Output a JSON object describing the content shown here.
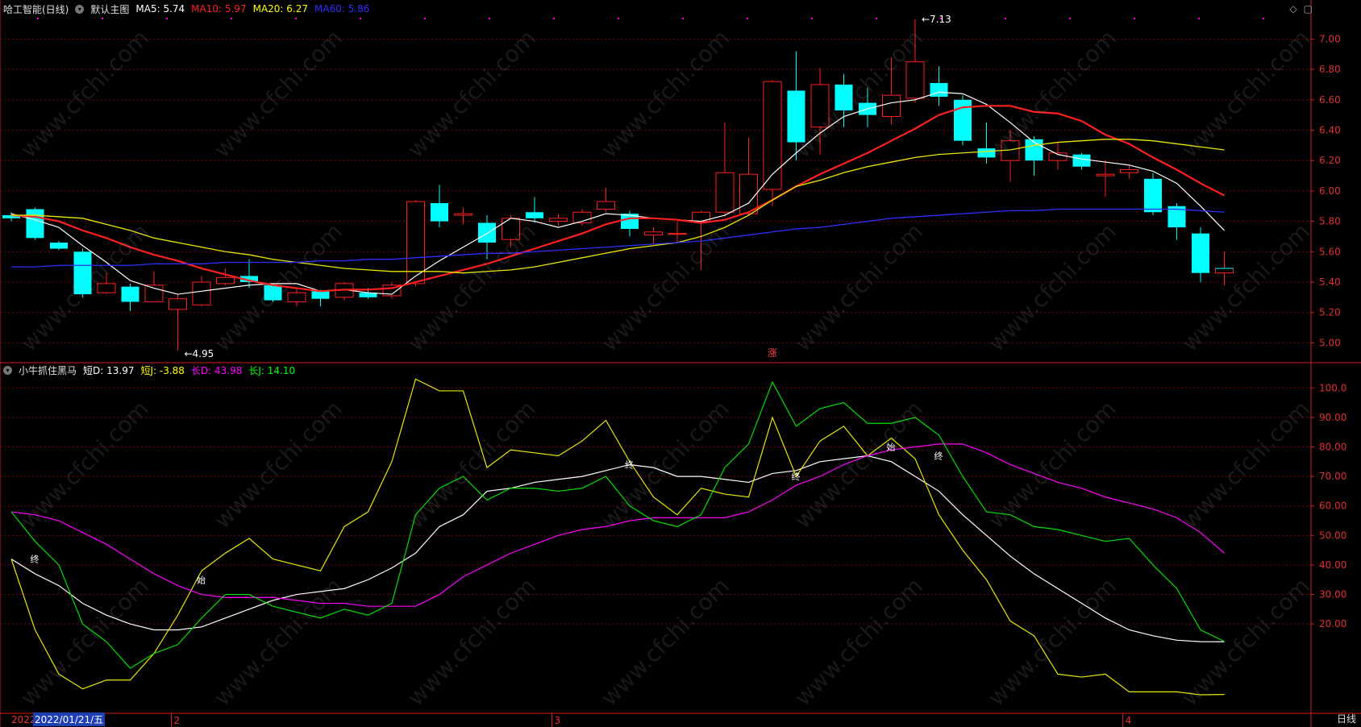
{
  "header": {
    "stock": "哈工智能(日线)",
    "template": "默认主图",
    "ma": [
      {
        "label": "MA5: 5.74",
        "color": "#ffffff"
      },
      {
        "label": "MA10: 5.97",
        "color": "#ff2020"
      },
      {
        "label": "MA20: 6.27",
        "color": "#ffff00"
      },
      {
        "label": "MA60: 5.86",
        "color": "#2f2fff"
      }
    ]
  },
  "indicator": {
    "name": "小牛抓住黑马",
    "items": [
      {
        "label": "短D: 13.97",
        "color": "#ffffff"
      },
      {
        "label": "短J: -3.88",
        "color": "#ffff00"
      },
      {
        "label": "长D: 43.98",
        "color": "#ff00ff"
      },
      {
        "label": "长J: 14.10",
        "color": "#00ff00"
      }
    ]
  },
  "footer": {
    "year": "2022",
    "date": "2022/01/21/五",
    "period": "日线"
  },
  "watermark": "www.cfchi.com",
  "colors": {
    "up": "#ff2020",
    "down": "#00ffff",
    "grid": "#7a0000",
    "axis": "#d21e1e"
  },
  "chart_data": {
    "type": "candlestick",
    "price_axis": {
      "ylim": [
        4.88,
        7.14
      ],
      "ticks": [
        "5.00",
        "5.20",
        "5.40",
        "5.60",
        "5.80",
        "6.00",
        "6.20",
        "6.40",
        "6.60",
        "6.80",
        "7.00"
      ]
    },
    "indicator_axis": {
      "ylim": [
        -10,
        108
      ],
      "ticks": [
        "20.00",
        "30.00",
        "40.00",
        "50.00",
        "60.00",
        "70.00",
        "80.00",
        "90.00",
        "100.0"
      ]
    },
    "month_labels": [
      {
        "label": "2",
        "index": 7
      },
      {
        "label": "3",
        "index": 23
      },
      {
        "label": "4",
        "index": 47
      }
    ],
    "candles": [
      [
        5.84,
        5.82,
        5.86,
        5.8
      ],
      [
        5.88,
        5.69,
        5.89,
        5.68
      ],
      [
        5.66,
        5.62,
        5.67,
        5.61
      ],
      [
        5.6,
        5.32,
        5.62,
        5.3
      ],
      [
        5.33,
        5.39,
        5.46,
        5.32
      ],
      [
        5.37,
        5.27,
        5.39,
        5.21
      ],
      [
        5.27,
        5.38,
        5.47,
        5.27
      ],
      [
        5.22,
        5.29,
        5.32,
        4.95
      ],
      [
        5.25,
        5.4,
        5.44,
        5.24
      ],
      [
        5.39,
        5.43,
        5.49,
        5.38
      ],
      [
        5.44,
        5.4,
        5.55,
        5.36
      ],
      [
        5.38,
        5.28,
        5.39,
        5.27
      ],
      [
        5.27,
        5.33,
        5.36,
        5.24
      ],
      [
        5.34,
        5.29,
        5.35,
        5.24
      ],
      [
        5.3,
        5.39,
        5.4,
        5.28
      ],
      [
        5.33,
        5.3,
        5.36,
        5.29
      ],
      [
        5.31,
        5.38,
        5.4,
        5.29
      ],
      [
        5.39,
        5.93,
        5.94,
        5.37
      ],
      [
        5.92,
        5.8,
        6.04,
        5.76
      ],
      [
        5.84,
        5.85,
        5.89,
        5.78
      ],
      [
        5.79,
        5.66,
        5.84,
        5.55
      ],
      [
        5.68,
        5.82,
        5.84,
        5.63
      ],
      [
        5.86,
        5.82,
        5.96,
        5.79
      ],
      [
        5.8,
        5.82,
        5.85,
        5.77
      ],
      [
        5.79,
        5.86,
        5.88,
        5.77
      ],
      [
        5.88,
        5.93,
        6.02,
        5.86
      ],
      [
        5.85,
        5.75,
        5.87,
        5.7
      ],
      [
        5.71,
        5.73,
        5.76,
        5.65
      ],
      [
        5.72,
        5.72,
        5.8,
        5.66
      ],
      [
        5.8,
        5.86,
        5.87,
        5.48
      ],
      [
        5.86,
        6.12,
        6.45,
        5.83
      ],
      [
        5.85,
        6.11,
        6.35,
        5.84
      ],
      [
        6.01,
        6.72,
        6.73,
        5.9
      ],
      [
        6.66,
        6.32,
        6.92,
        6.2
      ],
      [
        6.42,
        6.7,
        6.81,
        6.24
      ],
      [
        6.7,
        6.53,
        6.77,
        6.42
      ],
      [
        6.58,
        6.5,
        6.68,
        6.42
      ],
      [
        6.49,
        6.63,
        6.88,
        6.44
      ],
      [
        6.61,
        6.85,
        7.13,
        6.58
      ],
      [
        6.71,
        6.62,
        6.82,
        6.56
      ],
      [
        6.6,
        6.33,
        6.63,
        6.3
      ],
      [
        6.28,
        6.22,
        6.45,
        6.18
      ],
      [
        6.2,
        6.33,
        6.4,
        6.06
      ],
      [
        6.34,
        6.2,
        6.36,
        6.1
      ],
      [
        6.2,
        6.25,
        6.32,
        6.14
      ],
      [
        6.24,
        6.16,
        6.25,
        6.14
      ],
      [
        6.1,
        6.11,
        6.2,
        5.96
      ],
      [
        6.12,
        6.14,
        6.17,
        6.08
      ],
      [
        6.08,
        5.86,
        6.12,
        5.84
      ],
      [
        5.9,
        5.76,
        5.92,
        5.68
      ],
      [
        5.72,
        5.46,
        5.76,
        5.4
      ],
      [
        5.46,
        5.49,
        5.6,
        5.38
      ]
    ],
    "ma": {
      "MA5": [
        5.85,
        5.81,
        5.76,
        5.64,
        5.53,
        5.41,
        5.36,
        5.32,
        5.34,
        5.36,
        5.38,
        5.39,
        5.39,
        5.34,
        5.35,
        5.33,
        5.32,
        5.44,
        5.54,
        5.63,
        5.72,
        5.82,
        5.8,
        5.76,
        5.8,
        5.85,
        5.84,
        5.82,
        5.81,
        5.8,
        5.84,
        5.92,
        6.11,
        6.25,
        6.38,
        6.49,
        6.54,
        6.58,
        6.6,
        6.65,
        6.64,
        6.57,
        6.45,
        6.32,
        6.24,
        6.21,
        6.19,
        6.17,
        6.13,
        6.05,
        5.9,
        5.74
      ],
      "MA10": [
        5.84,
        5.83,
        5.8,
        5.74,
        5.69,
        5.63,
        5.58,
        5.54,
        5.49,
        5.45,
        5.41,
        5.38,
        5.36,
        5.34,
        5.35,
        5.35,
        5.36,
        5.4,
        5.44,
        5.48,
        5.52,
        5.57,
        5.62,
        5.67,
        5.72,
        5.78,
        5.82,
        5.82,
        5.81,
        5.79,
        5.81,
        5.86,
        5.94,
        6.03,
        6.11,
        6.18,
        6.25,
        6.33,
        6.41,
        6.5,
        6.55,
        6.56,
        6.56,
        6.52,
        6.51,
        6.46,
        6.37,
        6.31,
        6.22,
        6.14,
        6.05,
        5.97
      ],
      "MA20": [
        5.84,
        5.84,
        5.83,
        5.82,
        5.78,
        5.74,
        5.69,
        5.66,
        5.63,
        5.6,
        5.58,
        5.55,
        5.53,
        5.51,
        5.49,
        5.48,
        5.47,
        5.47,
        5.47,
        5.46,
        5.47,
        5.48,
        5.5,
        5.53,
        5.56,
        5.59,
        5.62,
        5.64,
        5.66,
        5.7,
        5.76,
        5.84,
        5.94,
        6.03,
        6.07,
        6.12,
        6.16,
        6.19,
        6.22,
        6.24,
        6.25,
        6.26,
        6.27,
        6.3,
        6.32,
        6.33,
        6.34,
        6.34,
        6.33,
        6.31,
        6.29,
        6.27
      ],
      "MA60": [
        5.5,
        5.5,
        5.51,
        5.51,
        5.51,
        5.51,
        5.52,
        5.52,
        5.52,
        5.53,
        5.53,
        5.53,
        5.53,
        5.54,
        5.54,
        5.55,
        5.55,
        5.56,
        5.57,
        5.58,
        5.59,
        5.59,
        5.6,
        5.61,
        5.62,
        5.63,
        5.64,
        5.65,
        5.66,
        5.67,
        5.69,
        5.71,
        5.73,
        5.75,
        5.76,
        5.78,
        5.8,
        5.82,
        5.83,
        5.84,
        5.85,
        5.86,
        5.87,
        5.87,
        5.88,
        5.88,
        5.88,
        5.88,
        5.88,
        5.88,
        5.87,
        5.86
      ]
    },
    "indicator_series": {
      "短D": [
        42,
        37,
        33,
        27,
        23,
        20,
        18,
        18,
        19,
        22,
        25,
        28,
        30,
        31,
        32,
        35,
        39,
        44,
        53,
        57,
        65,
        66,
        68,
        69,
        70,
        72,
        74,
        73,
        70,
        70,
        69,
        68,
        71,
        72,
        75,
        76,
        77,
        75,
        70,
        65,
        57,
        50,
        43,
        37,
        32,
        27,
        22,
        18,
        16,
        14.5,
        14,
        13.97
      ],
      "短J": [
        42,
        18,
        3,
        -2,
        1,
        1,
        10,
        23,
        38,
        44,
        49,
        42,
        40,
        38,
        53,
        58,
        75,
        103,
        99,
        99,
        73,
        79,
        78,
        77,
        82,
        89,
        75,
        63,
        57,
        66,
        64,
        63,
        90,
        70,
        82,
        87,
        77,
        83,
        76,
        57,
        45,
        35,
        21,
        16,
        3,
        2,
        3,
        -3,
        -3,
        -3,
        -4,
        -3.88
      ],
      "长D": [
        58,
        57,
        55,
        51,
        47,
        42,
        37,
        33,
        30,
        29,
        29,
        29,
        28,
        27,
        27,
        26,
        26,
        26,
        30,
        36,
        40,
        44,
        47,
        50,
        52,
        53,
        55,
        56,
        56,
        56,
        56,
        58,
        62,
        67,
        70,
        74,
        77,
        79,
        80,
        81,
        81,
        78,
        74,
        71,
        68,
        66,
        63,
        61,
        59,
        56,
        51,
        43.98
      ],
      "长J": [
        58,
        48,
        40,
        20,
        14,
        5,
        10,
        13,
        22,
        30,
        30,
        26,
        24,
        22,
        25,
        23,
        27,
        57,
        66,
        70,
        62,
        66,
        66,
        65,
        66,
        70,
        60,
        55,
        53,
        57,
        73,
        81,
        102,
        87,
        93,
        95,
        88,
        88,
        90,
        84,
        70,
        58,
        57,
        53,
        52,
        50,
        48,
        49,
        40,
        32,
        18,
        14.1
      ]
    },
    "annotations": [
      {
        "text": "7.13",
        "index": 38,
        "value": 7.13,
        "pane": "price"
      },
      {
        "text": "4.95",
        "index": 7,
        "value": 4.95,
        "pane": "price"
      },
      {
        "text": "涨",
        "index": 32,
        "pane": "divider"
      },
      {
        "text": "终",
        "index": 1,
        "value": 42,
        "pane": "indicator"
      },
      {
        "text": "始",
        "index": 8,
        "value": 35,
        "pane": "indicator"
      },
      {
        "text": "终",
        "index": 26,
        "value": 74,
        "pane": "indicator"
      },
      {
        "text": "终",
        "index": 33,
        "value": 70,
        "pane": "indicator"
      },
      {
        "text": "始",
        "index": 37,
        "value": 80,
        "pane": "indicator"
      },
      {
        "text": "终",
        "index": 39,
        "value": 77,
        "pane": "indicator"
      }
    ]
  }
}
